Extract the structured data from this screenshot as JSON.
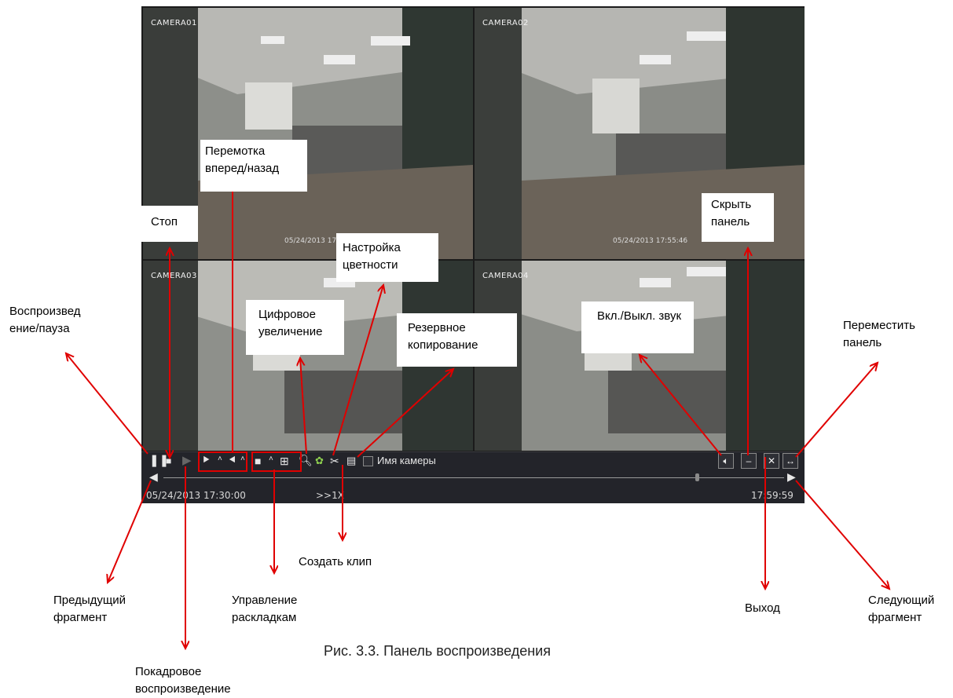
{
  "cameras": [
    {
      "label": "CAMERA01",
      "timestamp": "05/24/2013 17:55:46"
    },
    {
      "label": "CAMERA02",
      "timestamp": "05/24/2013 17:55:46"
    },
    {
      "label": "CAMERA03",
      "timestamp": ""
    },
    {
      "label": "CAMERA04",
      "timestamp": ""
    }
  ],
  "playback_bar": {
    "camera_name_label": "Имя камеры",
    "time_start": "05/24/2013 17:30:00",
    "speed": ">>1X",
    "time_end": "17:59:59",
    "progress": 0.86
  },
  "callouts": {
    "rewind": "Перемотка вперед/назад",
    "stop": "Стоп",
    "hide_panel": "Скрыть панель",
    "color_settings": "Настройка цветности",
    "play_pause": "Воспроизвед ение/пауза",
    "digital_zoom": "Цифровое увеличение",
    "backup": "Резервное копирование",
    "sound_toggle": "Вкл./Выкл. звук",
    "move_panel": "Переместить панель",
    "create_clip": "Создать клип",
    "prev_fragment": "Предыдущий фрагмент",
    "layout_control": "Управление раскладкам",
    "exit": "Выход",
    "next_fragment": "Следующий фрагмент",
    "frame_playback": "Покадровое воспроизведение"
  },
  "caption": "Рис. 3.3. Панель воспроизведения",
  "colors": {
    "arrow": "#e00000",
    "bar": "#23242a"
  }
}
